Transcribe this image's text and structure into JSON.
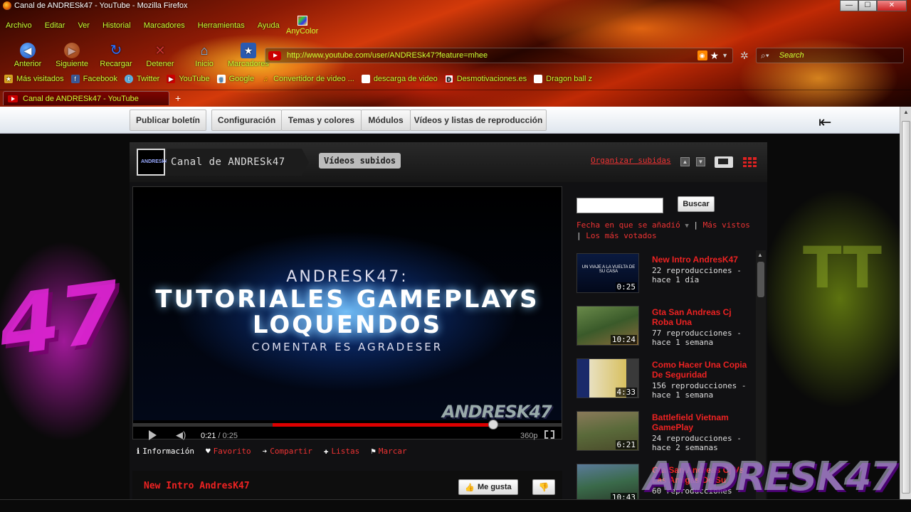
{
  "window": {
    "title": "Canal de ANDRESk47 - YouTube - Mozilla Firefox",
    "controls": {
      "minimize": "—",
      "maximize": "☐",
      "close": "✕"
    }
  },
  "menu": [
    "Archivo",
    "Editar",
    "Ver",
    "Historial",
    "Marcadores",
    "Herramientas",
    "Ayuda"
  ],
  "anycolor_label": "AnyColor",
  "nav": {
    "back": "Anterior",
    "forward": "Siguiente",
    "reload": "Recargar",
    "stop": "Detener",
    "home": "Inicio",
    "bookmarks": "Marcadores"
  },
  "urlbar": {
    "url": "http://www.youtube.com/user/ANDRESk47?feature=mhee"
  },
  "searchbar": {
    "placeholder": "Search"
  },
  "bookmarks": [
    {
      "label": "Más visitados",
      "icon": "star-icon"
    },
    {
      "label": "Facebook",
      "icon": "facebook-icon"
    },
    {
      "label": "Twitter",
      "icon": "twitter-icon"
    },
    {
      "label": "YouTube",
      "icon": "youtube-icon"
    },
    {
      "label": "Google",
      "icon": "google-icon"
    },
    {
      "label": "Convertidor de video ...",
      "icon": "music-note-icon"
    },
    {
      "label": "descarga de video",
      "icon": "page-icon"
    },
    {
      "label": "Desmotivaciones.es",
      "icon": "desmotivaciones-icon"
    },
    {
      "label": "Dragon ball z",
      "icon": "page-icon"
    }
  ],
  "tab": {
    "label": "Canal de ANDRESk47 - YouTube",
    "new_tab": "+"
  },
  "toolbar": {
    "publish": "Publicar boletín",
    "config": "Configuración",
    "themes": "Temas y colores",
    "modules": "Módulos",
    "videos_lists": "Vídeos y listas de reproducción"
  },
  "channel": {
    "avatar_text": "ANDRESk47",
    "name": "Canal de ANDRESk47",
    "uploaded_pill": "Vídeos subidos",
    "organize_link": "Organizar subidas"
  },
  "player": {
    "lines": [
      "ANDRESK47:",
      "TUTORIALES GAMEPLAYS",
      "LOQUENDOS",
      "COMENTAR ES AGRADESER"
    ],
    "watermark": "ANDRESK47",
    "current_time": "0:21",
    "duration": "/ 0:25",
    "progress_played": 0.84,
    "quality": "360p"
  },
  "info_tabs": [
    "Información",
    "Favorito",
    "Compartir",
    "Listas",
    "Marcar"
  ],
  "video_title": "New Intro AndresK47",
  "like_label": "Me gusta",
  "sidebar": {
    "search_button": "Buscar",
    "sort_date": "Fecha en que se añadió",
    "sort_sep1": "|",
    "sort_views": "Más vistos",
    "sort_sep2": "|",
    "sort_rated": "Los más votados",
    "videos": [
      {
        "title": "New Intro AndresK47",
        "views": "22 reproducciones -",
        "age": "hace 1 día",
        "duration": "0:25",
        "thumb_text": "UN VIAJE A LA VUELTA DE SU CASA"
      },
      {
        "title": "Gta San Andreas Cj Roba Una",
        "views": "77 reproducciones -",
        "age": "hace 1 semana",
        "duration": "10:24",
        "thumb_text": ""
      },
      {
        "title": "Como Hacer Una Copia De Seguridad",
        "views": "156 reproducciones -",
        "age": "hace 1 semana",
        "duration": "4:33",
        "thumb_text": ""
      },
      {
        "title": "Battlefield Vietnam GamePlay",
        "views": "24 reproducciones -",
        "age": "hace 2 semanas",
        "duration": "6:21",
        "thumb_text": ""
      },
      {
        "title": "Gta San Andreas Cj Vs Las Amigas De Su",
        "views": "60 reproducciones -",
        "age": "",
        "duration": "10:43",
        "thumb_text": ""
      }
    ]
  },
  "overlay_watermark": "ANDRESK47",
  "colors": {
    "accent": "#e22222",
    "link_green": "#c9ff33",
    "toolbar_bg": "#eef2f6"
  }
}
